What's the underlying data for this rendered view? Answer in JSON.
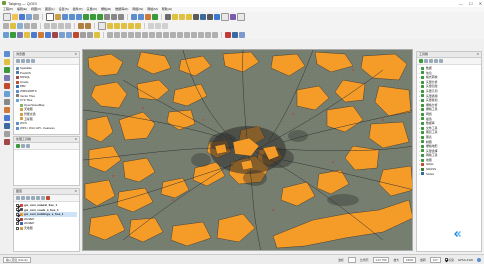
{
  "window": {
    "title": "Taiqing — QGIS",
    "min": "—",
    "max": "☐",
    "close": "✕"
  },
  "menu": [
    "工程(P)",
    "编辑(E)",
    "视图(V)",
    "图层(L)",
    "设置(S)",
    "插件(P)",
    "矢量(O)",
    "栅格(R)",
    "数据库(D)",
    "网络(W)",
    "网格(M)",
    "帮助(H)"
  ],
  "browser": {
    "title": "浏览器",
    "items": [
      {
        "label": "Spatialite",
        "color": "#6b8fb5"
      },
      {
        "label": "PostGIS",
        "color": "#4f79a8"
      },
      {
        "label": "MSSQL",
        "color": "#a04848"
      },
      {
        "label": "Oracle",
        "color": "#c04a2a"
      },
      {
        "label": "DB2",
        "color": "#2e6fb0"
      },
      {
        "label": "WMS/WMTS",
        "color": "#5a8ed0"
      },
      {
        "label": "Vector Tiles",
        "color": "#777"
      },
      {
        "label": "XYZ Tiles",
        "color": "#6aa0d8"
      },
      {
        "label": "OpenStreetMap",
        "color": "#7fb36a"
      },
      {
        "label": "天地图",
        "color": "#d0a040"
      },
      {
        "label": "智能交通",
        "color": "#d0a040"
      },
      {
        "label": "卫星图",
        "color": "#d0a040"
      },
      {
        "label": "WCS",
        "color": "#5a8ed0"
      },
      {
        "label": "WFS / OGC API - Features",
        "color": "#5a8ed0"
      }
    ]
  },
  "processing": {
    "title": "处理工具箱"
  },
  "layers": {
    "title": "图层",
    "items": [
      {
        "label": "gis_osm_natural_free_1",
        "checked": true,
        "color": "#e0443a",
        "bold": true
      },
      {
        "label": "gis_osm_roads_a_free_1",
        "checked": true,
        "color": "#555555",
        "bold": true
      },
      {
        "label": "gis_osm_buildings_a_free_1",
        "checked": true,
        "color": "#f49b28",
        "bold": true
      },
      {
        "label": "2022EP",
        "checked": true,
        "color": "#b04040",
        "bold": false
      },
      {
        "label": "2023EP",
        "checked": false,
        "color": "#4060b0",
        "bold": false
      },
      {
        "label": "天地图",
        "checked": false,
        "color": "#d0a040",
        "bold": false
      }
    ]
  },
  "toolbox": {
    "title": "工具箱",
    "items": [
      {
        "label": "数据",
        "color": "#3a9a3a"
      },
      {
        "label": "信息",
        "color": "#3a9a3a"
      },
      {
        "label": "格式转换",
        "color": "#3a9a3a"
      },
      {
        "label": "矢量分析",
        "color": "#3a9a3a"
      },
      {
        "label": "矢量创建",
        "color": "#3a9a3a"
      },
      {
        "label": "矢量几何",
        "color": "#3a9a3a"
      },
      {
        "label": "矢量通用",
        "color": "#3a9a3a"
      },
      {
        "label": "矢量叠加",
        "color": "#3a9a3a"
      },
      {
        "label": "栅格分析",
        "color": "#3a9a3a"
      },
      {
        "label": "栅格工具",
        "color": "#3a9a3a"
      },
      {
        "label": "网络",
        "color": "#3a9a3a"
      },
      {
        "label": "插值",
        "color": "#3a9a3a"
      },
      {
        "label": "数据库",
        "color": "#3a9a3a"
      },
      {
        "label": "文件工具",
        "color": "#3a9a3a"
      },
      {
        "label": "图层工具",
        "color": "#3a9a3a"
      },
      {
        "label": "图表",
        "color": "#3a9a3a"
      },
      {
        "label": "制图",
        "color": "#3a9a3a"
      },
      {
        "label": "栅格地形",
        "color": "#3a9a3a"
      },
      {
        "label": "矢量选择",
        "color": "#3a9a3a"
      },
      {
        "label": "网格工具",
        "color": "#3a9a3a"
      },
      {
        "label": "地图",
        "color": "#3a9a3a"
      },
      {
        "label": "GDAL",
        "color": "#c04a2a"
      },
      {
        "label": "GRASS",
        "color": "#3a7a3a"
      },
      {
        "label": "SAGA",
        "color": "#2a6aa0"
      }
    ]
  },
  "status": {
    "search_placeholder": "输入定位 (Ctrl+K)",
    "coord_label": "坐标",
    "coord_value": "...",
    "scale_label": "比例尺",
    "scale_value": "1:47 760",
    "magnifier_label": "放大",
    "magnifier_value": "100%",
    "rotation_label": "旋转",
    "rotation_value": "0.0°",
    "render_label": "渲染",
    "crs_label": "EPSG:4326"
  },
  "colors": {
    "map_bg": "#727a6b",
    "natural": "#f49b28",
    "roads": "#3c3c3c",
    "accent": "#1e88e5"
  }
}
